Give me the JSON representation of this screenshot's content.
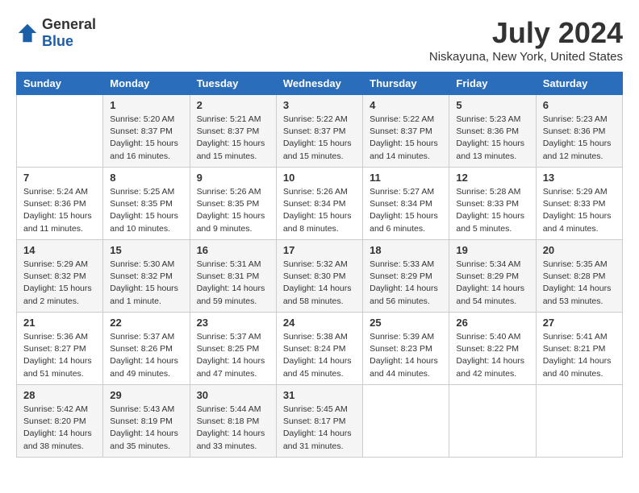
{
  "header": {
    "logo_general": "General",
    "logo_blue": "Blue",
    "title": "July 2024",
    "subtitle": "Niskayuna, New York, United States"
  },
  "calendar": {
    "days_of_week": [
      "Sunday",
      "Monday",
      "Tuesday",
      "Wednesday",
      "Thursday",
      "Friday",
      "Saturday"
    ],
    "weeks": [
      [
        {
          "day": "",
          "info": ""
        },
        {
          "day": "1",
          "info": "Sunrise: 5:20 AM\nSunset: 8:37 PM\nDaylight: 15 hours\nand 16 minutes."
        },
        {
          "day": "2",
          "info": "Sunrise: 5:21 AM\nSunset: 8:37 PM\nDaylight: 15 hours\nand 15 minutes."
        },
        {
          "day": "3",
          "info": "Sunrise: 5:22 AM\nSunset: 8:37 PM\nDaylight: 15 hours\nand 15 minutes."
        },
        {
          "day": "4",
          "info": "Sunrise: 5:22 AM\nSunset: 8:37 PM\nDaylight: 15 hours\nand 14 minutes."
        },
        {
          "day": "5",
          "info": "Sunrise: 5:23 AM\nSunset: 8:36 PM\nDaylight: 15 hours\nand 13 minutes."
        },
        {
          "day": "6",
          "info": "Sunrise: 5:23 AM\nSunset: 8:36 PM\nDaylight: 15 hours\nand 12 minutes."
        }
      ],
      [
        {
          "day": "7",
          "info": "Sunrise: 5:24 AM\nSunset: 8:36 PM\nDaylight: 15 hours\nand 11 minutes."
        },
        {
          "day": "8",
          "info": "Sunrise: 5:25 AM\nSunset: 8:35 PM\nDaylight: 15 hours\nand 10 minutes."
        },
        {
          "day": "9",
          "info": "Sunrise: 5:26 AM\nSunset: 8:35 PM\nDaylight: 15 hours\nand 9 minutes."
        },
        {
          "day": "10",
          "info": "Sunrise: 5:26 AM\nSunset: 8:34 PM\nDaylight: 15 hours\nand 8 minutes."
        },
        {
          "day": "11",
          "info": "Sunrise: 5:27 AM\nSunset: 8:34 PM\nDaylight: 15 hours\nand 6 minutes."
        },
        {
          "day": "12",
          "info": "Sunrise: 5:28 AM\nSunset: 8:33 PM\nDaylight: 15 hours\nand 5 minutes."
        },
        {
          "day": "13",
          "info": "Sunrise: 5:29 AM\nSunset: 8:33 PM\nDaylight: 15 hours\nand 4 minutes."
        }
      ],
      [
        {
          "day": "14",
          "info": "Sunrise: 5:29 AM\nSunset: 8:32 PM\nDaylight: 15 hours\nand 2 minutes."
        },
        {
          "day": "15",
          "info": "Sunrise: 5:30 AM\nSunset: 8:32 PM\nDaylight: 15 hours\nand 1 minute."
        },
        {
          "day": "16",
          "info": "Sunrise: 5:31 AM\nSunset: 8:31 PM\nDaylight: 14 hours\nand 59 minutes."
        },
        {
          "day": "17",
          "info": "Sunrise: 5:32 AM\nSunset: 8:30 PM\nDaylight: 14 hours\nand 58 minutes."
        },
        {
          "day": "18",
          "info": "Sunrise: 5:33 AM\nSunset: 8:29 PM\nDaylight: 14 hours\nand 56 minutes."
        },
        {
          "day": "19",
          "info": "Sunrise: 5:34 AM\nSunset: 8:29 PM\nDaylight: 14 hours\nand 54 minutes."
        },
        {
          "day": "20",
          "info": "Sunrise: 5:35 AM\nSunset: 8:28 PM\nDaylight: 14 hours\nand 53 minutes."
        }
      ],
      [
        {
          "day": "21",
          "info": "Sunrise: 5:36 AM\nSunset: 8:27 PM\nDaylight: 14 hours\nand 51 minutes."
        },
        {
          "day": "22",
          "info": "Sunrise: 5:37 AM\nSunset: 8:26 PM\nDaylight: 14 hours\nand 49 minutes."
        },
        {
          "day": "23",
          "info": "Sunrise: 5:37 AM\nSunset: 8:25 PM\nDaylight: 14 hours\nand 47 minutes."
        },
        {
          "day": "24",
          "info": "Sunrise: 5:38 AM\nSunset: 8:24 PM\nDaylight: 14 hours\nand 45 minutes."
        },
        {
          "day": "25",
          "info": "Sunrise: 5:39 AM\nSunset: 8:23 PM\nDaylight: 14 hours\nand 44 minutes."
        },
        {
          "day": "26",
          "info": "Sunrise: 5:40 AM\nSunset: 8:22 PM\nDaylight: 14 hours\nand 42 minutes."
        },
        {
          "day": "27",
          "info": "Sunrise: 5:41 AM\nSunset: 8:21 PM\nDaylight: 14 hours\nand 40 minutes."
        }
      ],
      [
        {
          "day": "28",
          "info": "Sunrise: 5:42 AM\nSunset: 8:20 PM\nDaylight: 14 hours\nand 38 minutes."
        },
        {
          "day": "29",
          "info": "Sunrise: 5:43 AM\nSunset: 8:19 PM\nDaylight: 14 hours\nand 35 minutes."
        },
        {
          "day": "30",
          "info": "Sunrise: 5:44 AM\nSunset: 8:18 PM\nDaylight: 14 hours\nand 33 minutes."
        },
        {
          "day": "31",
          "info": "Sunrise: 5:45 AM\nSunset: 8:17 PM\nDaylight: 14 hours\nand 31 minutes."
        },
        {
          "day": "",
          "info": ""
        },
        {
          "day": "",
          "info": ""
        },
        {
          "day": "",
          "info": ""
        }
      ]
    ]
  }
}
